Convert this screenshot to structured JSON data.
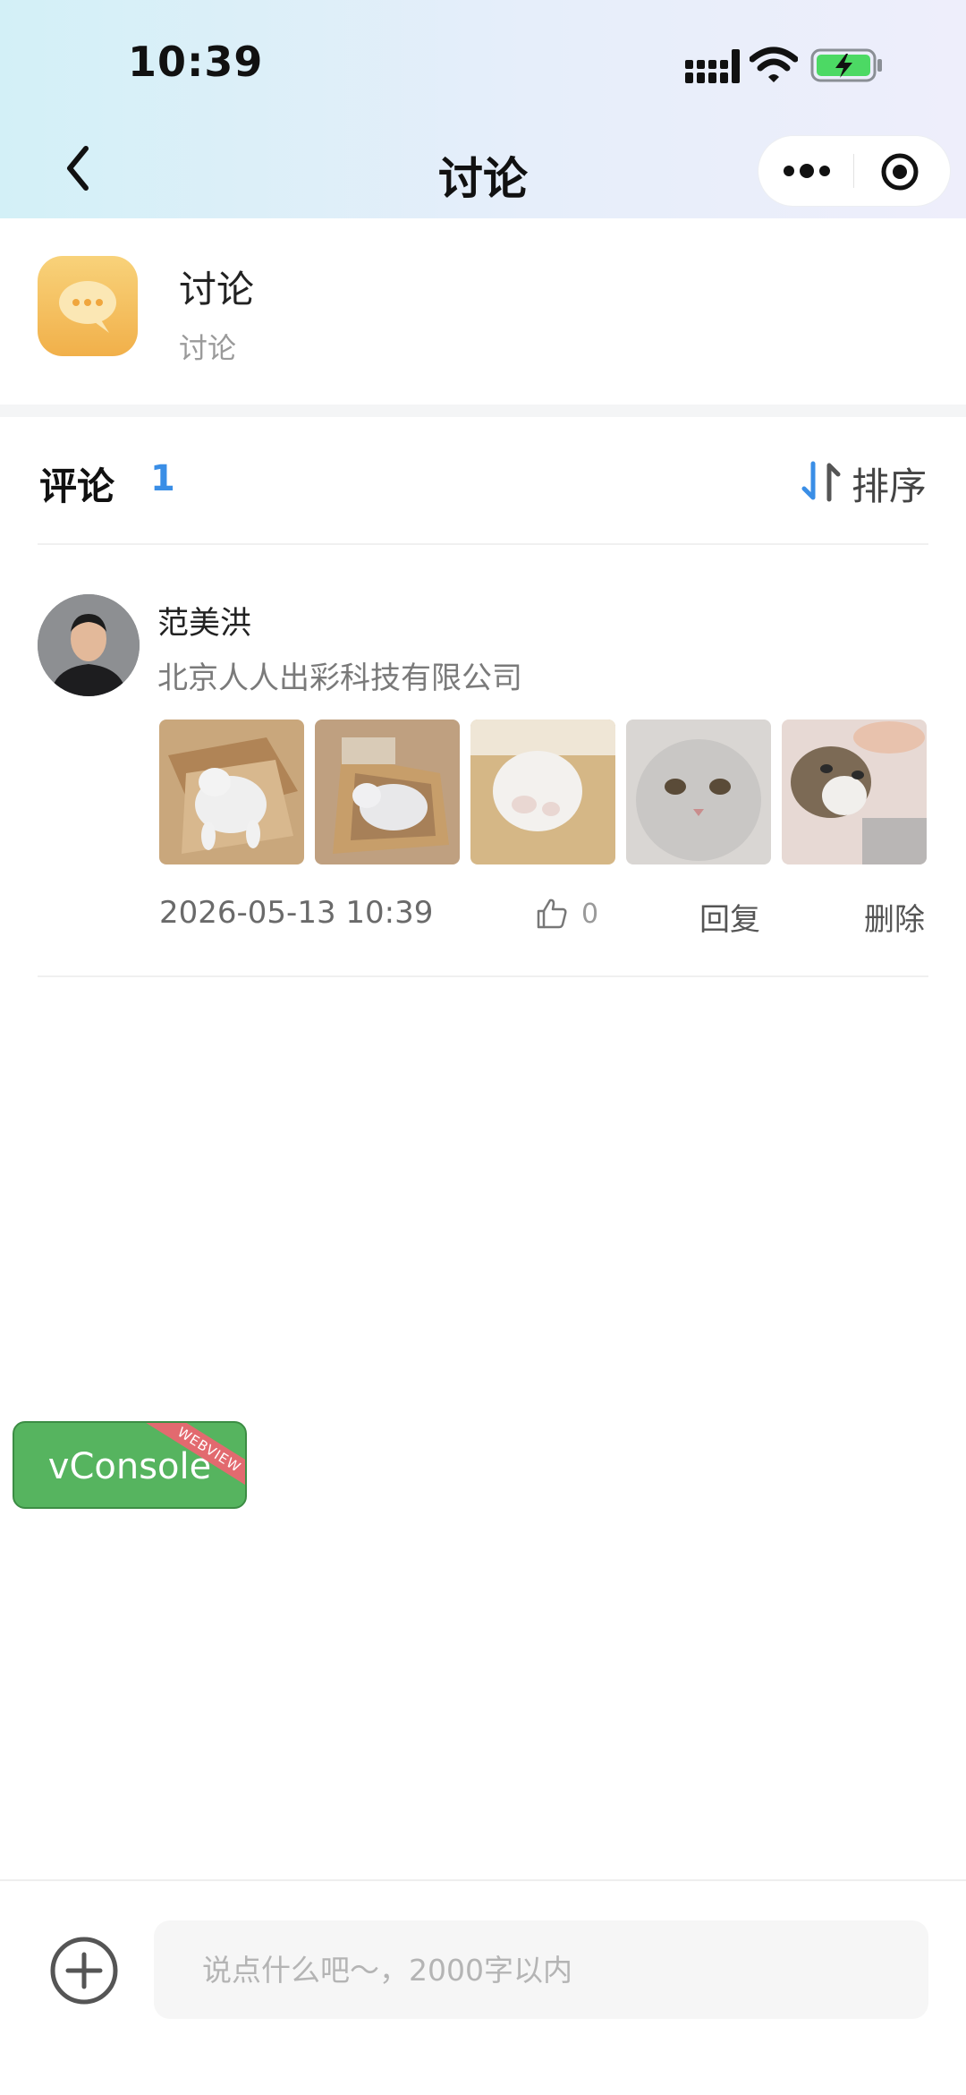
{
  "status_bar": {
    "time": "10:39"
  },
  "nav": {
    "title": "讨论"
  },
  "header": {
    "title": "讨论",
    "subtitle": "讨论"
  },
  "comments": {
    "label": "评论",
    "count": "1",
    "sort_label": "排序",
    "items": [
      {
        "user_name": "范美洪",
        "company": "北京人人出彩科技有限公司",
        "timestamp": "2026-05-13 10:39",
        "likes": "0",
        "reply_label": "回复",
        "delete_label": "删除",
        "photos": [
          "cat-photo",
          "cat-photo",
          "cat-photo",
          "cat-photo",
          "cat-photo"
        ]
      }
    ]
  },
  "vconsole": {
    "label": "vConsole",
    "badge": "WEBVIEW"
  },
  "input_bar": {
    "placeholder": "说点什么吧～，2000字以内",
    "value": ""
  },
  "icons": [
    "back-icon",
    "more-icon",
    "target-icon",
    "chat-bubble-icon",
    "sort-icon",
    "like-icon",
    "add-icon",
    "signal-icon",
    "wifi-icon",
    "battery-icon"
  ],
  "colors": {
    "accent_blue": "#3a8ee6",
    "vconsole_green": "#56b45f",
    "app_icon_yellow": "#f4bf5c"
  }
}
